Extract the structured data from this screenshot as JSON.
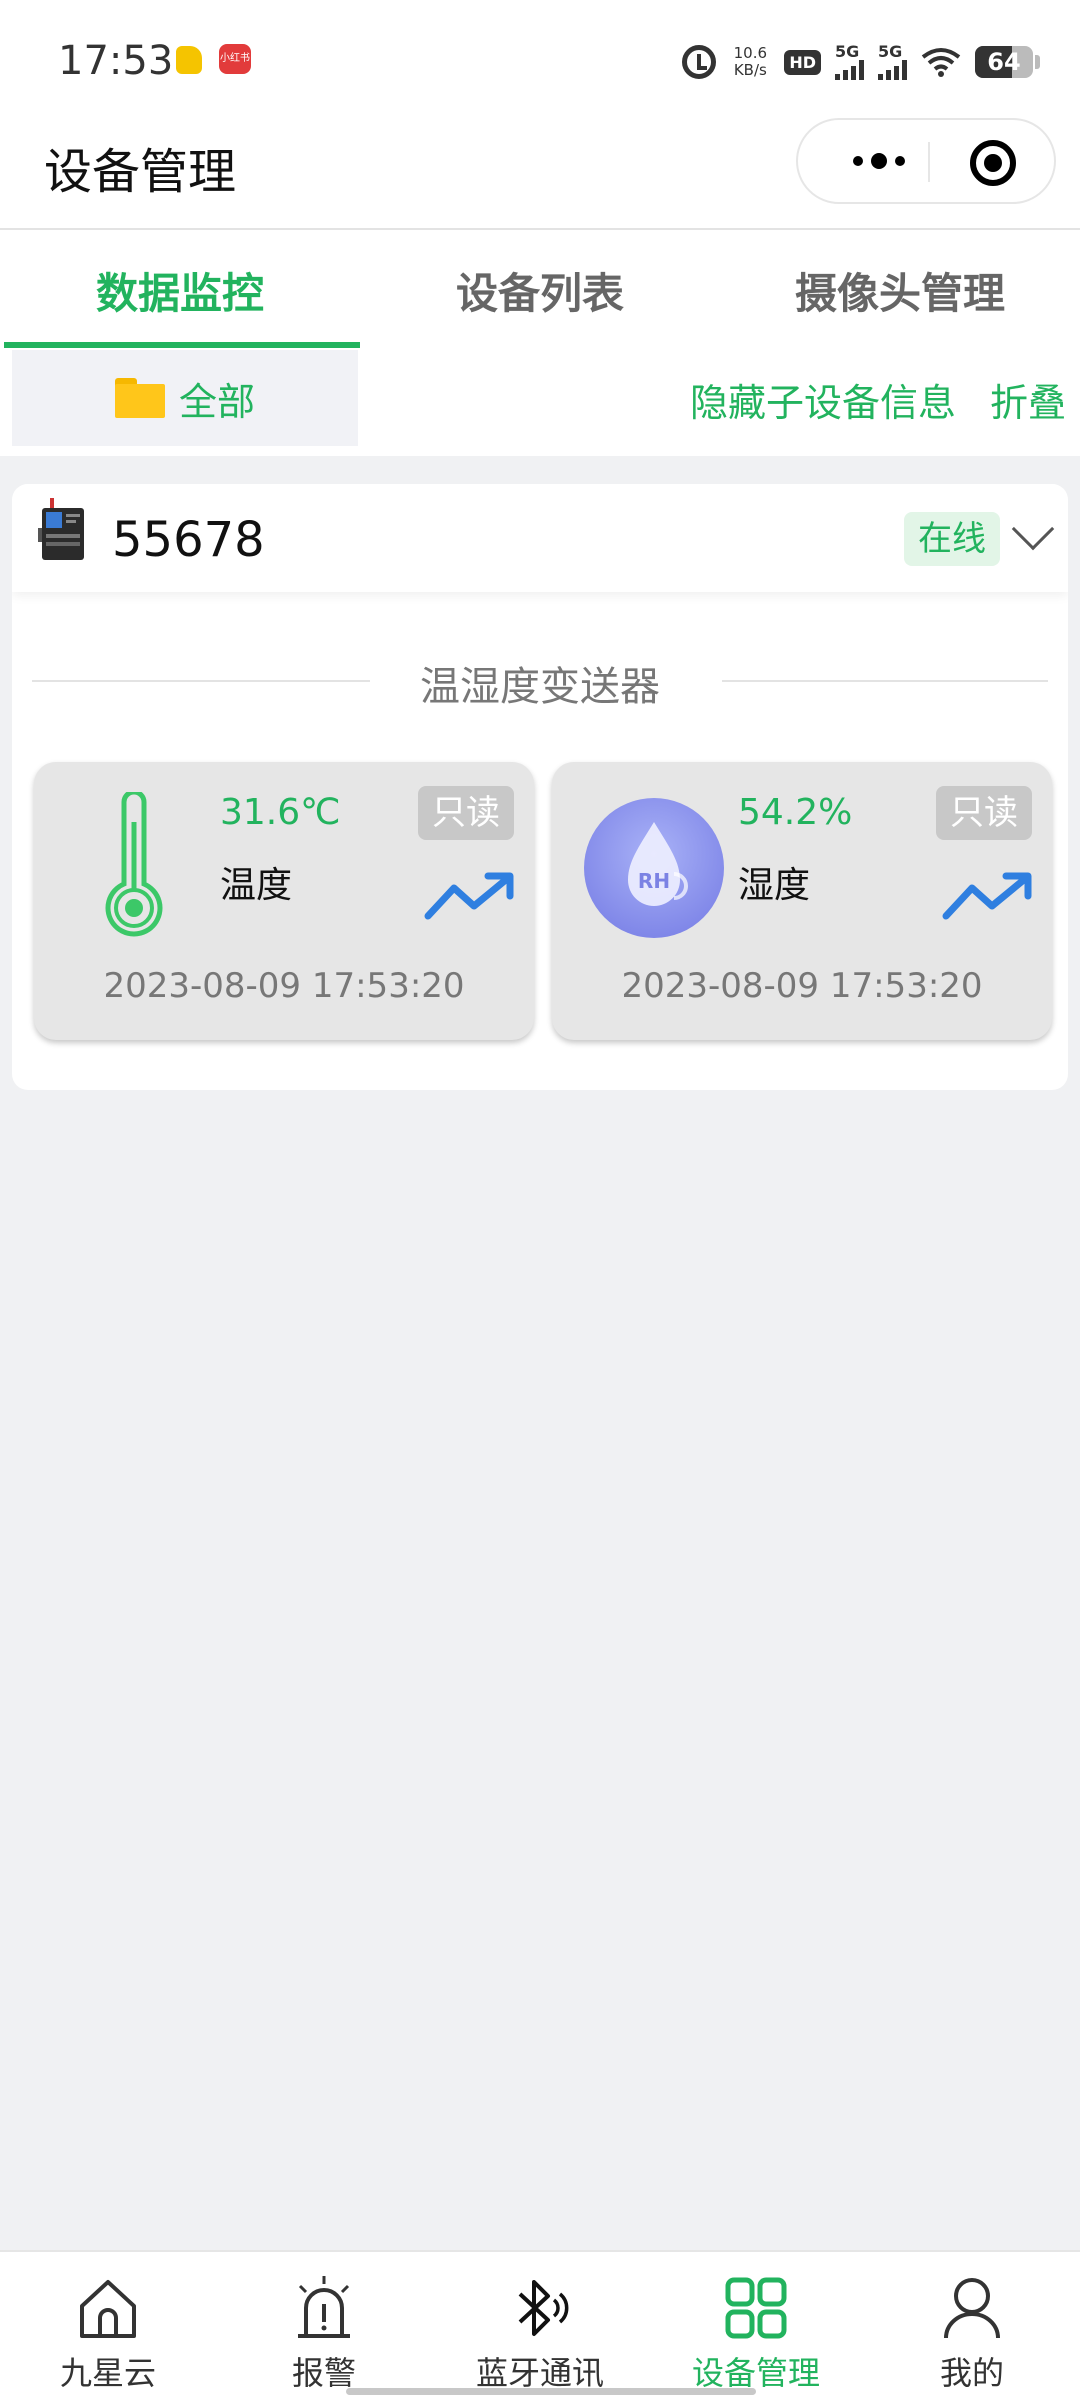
{
  "status_bar": {
    "time": "17:53",
    "app_badge_text": "小红书",
    "net_speed_value": "10.6",
    "net_speed_unit": "KB/s",
    "hd_label": "HD",
    "sim1": "1",
    "sim2": "2",
    "signal1_label": "5G",
    "signal2_label": "5G",
    "battery": "64"
  },
  "nav": {
    "title": "设备管理"
  },
  "tabs": [
    {
      "label": "数据监控",
      "active": true
    },
    {
      "label": "设备列表",
      "active": false
    },
    {
      "label": "摄像头管理",
      "active": false
    }
  ],
  "filter": {
    "folder_label": "全部",
    "hide_sub_info": "隐藏子设备信息",
    "fold": "折叠"
  },
  "device": {
    "name": "55678",
    "status": "在线",
    "group_title": "温湿度变送器",
    "sensors": [
      {
        "value": "31.6℃",
        "label": "温度",
        "badge": "只读",
        "time": "2023-08-09 17:53:20",
        "icon": "thermometer-icon"
      },
      {
        "value": "54.2%",
        "label": "湿度",
        "badge": "只读",
        "time": "2023-08-09 17:53:20",
        "icon": "humidity-rh-icon",
        "icon_text": "RH"
      }
    ]
  },
  "tabbar": [
    {
      "label": "九星云",
      "icon": "home-icon",
      "active": false
    },
    {
      "label": "报警",
      "icon": "alarm-icon",
      "active": false
    },
    {
      "label": "蓝牙通讯",
      "icon": "bluetooth-icon",
      "active": false
    },
    {
      "label": "设备管理",
      "icon": "grid-icon",
      "active": true
    },
    {
      "label": "我的",
      "icon": "user-icon",
      "active": false
    }
  ],
  "colors": {
    "accent": "#22b35e",
    "background": "#f0f1f3",
    "sensor_card": "#e6e6e6",
    "badge_gray": "#c8c8c8",
    "trend_blue": "#2f7fe0",
    "folder_yellow": "#ffc61a"
  }
}
